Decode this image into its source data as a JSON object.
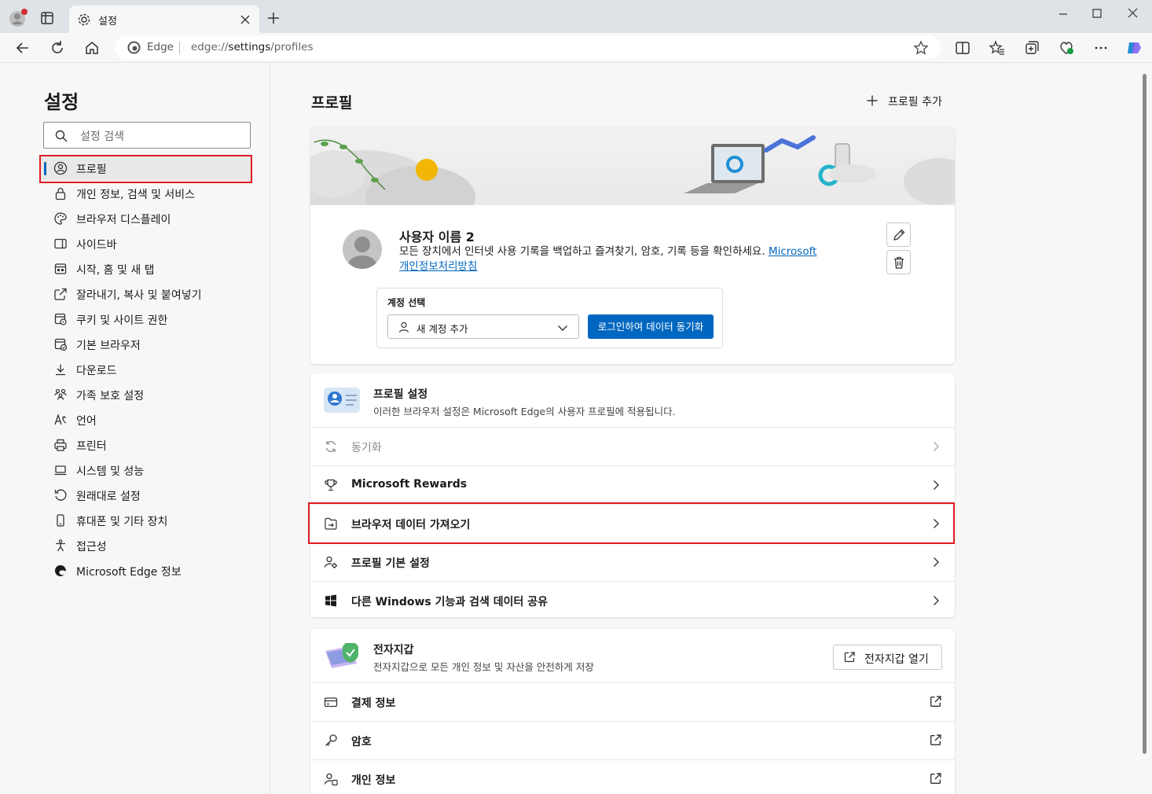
{
  "browser": {
    "tab_title": "설정",
    "address": {
      "badge": "Edge",
      "url_prefix": "edge://",
      "url_main": "settings",
      "url_suffix": "/profiles"
    }
  },
  "sidebar": {
    "title": "설정",
    "search_placeholder": "설정 검색",
    "items": [
      {
        "label": "프로필",
        "icon": "profile-icon",
        "active": true
      },
      {
        "label": "개인 정보, 검색 및 서비스",
        "icon": "lock-icon"
      },
      {
        "label": "브라우저 디스플레이",
        "icon": "palette-icon"
      },
      {
        "label": "사이드바",
        "icon": "sidebar-icon"
      },
      {
        "label": "시작, 홈 및 새 탭",
        "icon": "home-tab-icon"
      },
      {
        "label": "잘라내기, 복사 및 붙여넣기",
        "icon": "share-icon"
      },
      {
        "label": "쿠키 및 사이트 권한",
        "icon": "cookie-icon"
      },
      {
        "label": "기본 브라우저",
        "icon": "browser-icon"
      },
      {
        "label": "다운로드",
        "icon": "download-icon"
      },
      {
        "label": "가족 보호 설정",
        "icon": "family-icon"
      },
      {
        "label": "언어",
        "icon": "language-icon"
      },
      {
        "label": "프린터",
        "icon": "printer-icon"
      },
      {
        "label": "시스템 및 성능",
        "icon": "laptop-icon"
      },
      {
        "label": "원래대로 설정",
        "icon": "reset-icon"
      },
      {
        "label": "휴대폰 및 기타 장치",
        "icon": "phone-icon"
      },
      {
        "label": "접근성",
        "icon": "accessibility-icon"
      },
      {
        "label": "Microsoft Edge 정보",
        "icon": "edge-icon"
      }
    ]
  },
  "main": {
    "title": "프로필",
    "add_profile": "프로필 추가",
    "profile": {
      "name": "사용자 이름 2",
      "description": "모든 장치에서 인터넷 사용 기록을 백업하고 즐겨찾기, 암호, 기록 등을 확인하세요.",
      "link_line1": "Microsoft",
      "link_line2": "개인정보처리방침",
      "account_label": "계정 선택",
      "account_select": "새 계정 추가",
      "sync_button": "로그인하여 데이터 동기화"
    },
    "profile_settings": {
      "title": "프로필 설정",
      "subtitle": "이러한 브라우저 설정은 Microsoft Edge의 사용자 프로필에 적용됩니다.",
      "rows": [
        {
          "label": "동기화",
          "icon": "sync-icon",
          "disabled": true
        },
        {
          "label": "Microsoft Rewards",
          "icon": "trophy-icon"
        },
        {
          "label": "브라우저 데이터 가져오기",
          "icon": "import-icon"
        },
        {
          "label": "프로필 기본 설정",
          "icon": "profile-settings-icon"
        },
        {
          "label": "다른 Windows 기능과 검색 데이터 공유",
          "icon": "windows-icon"
        }
      ]
    },
    "wallet": {
      "title": "전자지갑",
      "subtitle": "전자지갑으로 모든 개인 정보 및 자산을 안전하게 저장",
      "open_button": "전자지갑 열기",
      "rows": [
        {
          "label": "결제 정보",
          "icon": "card-icon"
        },
        {
          "label": "암호",
          "icon": "key-icon"
        },
        {
          "label": "개인 정보",
          "icon": "personal-info-icon"
        }
      ]
    }
  },
  "colors": {
    "accent": "#0067c0",
    "highlight": "#e01b24"
  }
}
